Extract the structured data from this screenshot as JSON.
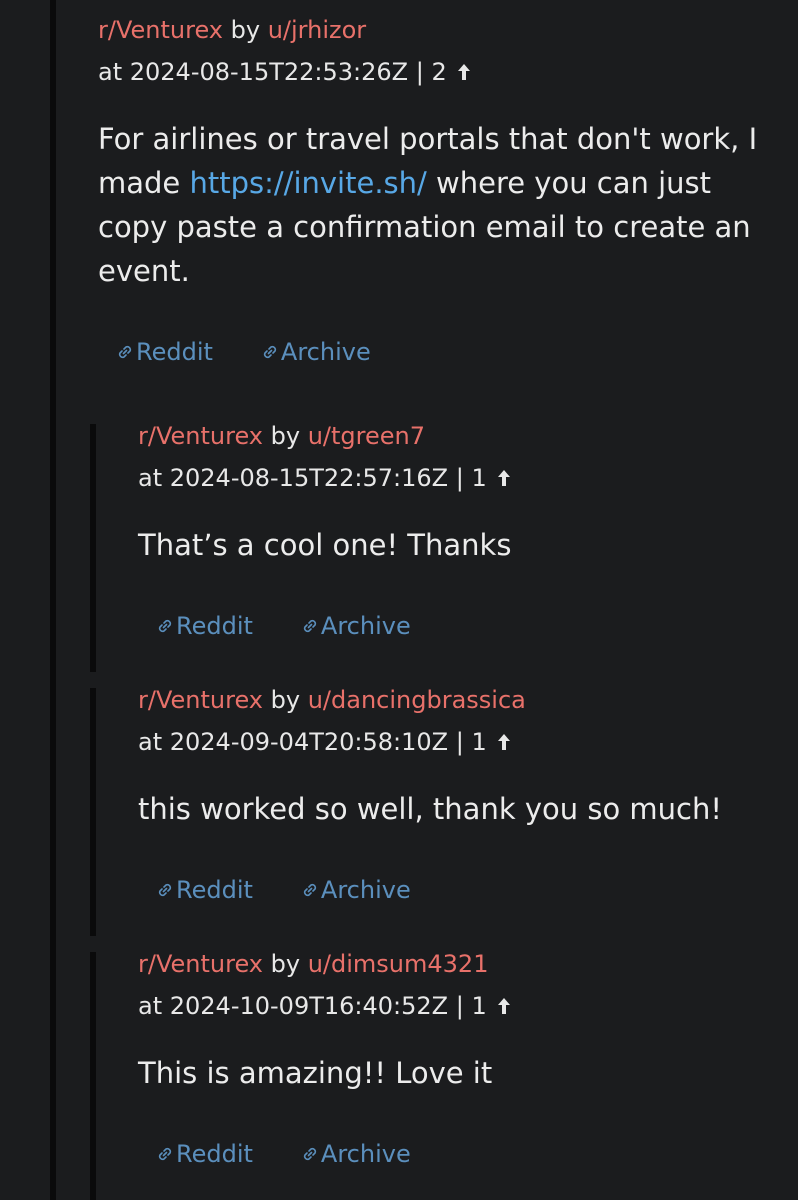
{
  "comments": [
    {
      "subreddit": "r/Venturex",
      "by": "by",
      "user": "u/jrhizor",
      "timestamp": "at 2024-08-15T22:53:26Z | 2",
      "body_pre": "For airlines or travel portals that don't work, I made ",
      "body_link": "https://invite.sh/",
      "body_post": " where you can just copy paste a confirmation email to create an event.",
      "reddit_label": "Reddit",
      "archive_label": "Archive"
    },
    {
      "subreddit": "r/Venturex",
      "by": "by",
      "user": "u/tgreen7",
      "timestamp": "at 2024-08-15T22:57:16Z | 1",
      "body": "That’s a cool one! Thanks",
      "reddit_label": "Reddit",
      "archive_label": "Archive"
    },
    {
      "subreddit": "r/Venturex",
      "by": "by",
      "user": "u/dancingbrassica",
      "timestamp": "at 2024-09-04T20:58:10Z | 1",
      "body": "this worked so well, thank you so much!",
      "reddit_label": "Reddit",
      "archive_label": "Archive"
    },
    {
      "subreddit": "r/Venturex",
      "by": "by",
      "user": "u/dimsum4321",
      "timestamp": "at 2024-10-09T16:40:52Z | 1",
      "body": "This is amazing!! Love it",
      "reddit_label": "Reddit",
      "archive_label": "Archive"
    }
  ],
  "colors": {
    "background": "#1b1c1e",
    "subreddit_user": "#e8716a",
    "link": "#58a8e6",
    "action_link": "#5b8fbd",
    "thread_line": "#0a0a0b"
  },
  "icons": {
    "upvote": "upvote-arrow-icon",
    "link": "link-chain-icon"
  }
}
